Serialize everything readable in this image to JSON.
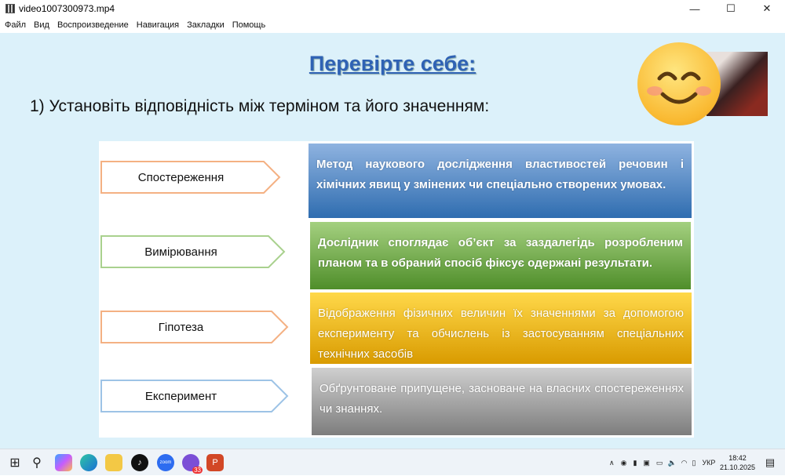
{
  "window": {
    "title": "video1007300973.mp4",
    "min": "—",
    "max": "☐",
    "close": "✕"
  },
  "menu": [
    "Файл",
    "Вид",
    "Воспроизведение",
    "Навигация",
    "Закладки",
    "Помощь"
  ],
  "slide": {
    "title": "Перевірте себе:",
    "subtitle": "1) Установіть відповідність між терміном та його значенням:",
    "terms": [
      {
        "label": "Спостереження",
        "color": "#f4b183"
      },
      {
        "label": "Вимірювання",
        "color": "#a9d18e"
      },
      {
        "label": "Гіпотеза",
        "color": "#f4b183"
      },
      {
        "label": "Експеримент",
        "color": "#9dc3e6"
      }
    ],
    "definitions": [
      "Метод наукового дослідження властивостей речовин і хімічних явищ  у змінених чи спеціально створених умовах.",
      "Дослідник споглядає об’єкт за заздалегідь розробленим планом та в обраний спосіб фіксує одержані результати.",
      "Відображення фізичних величин їх значеннями за допомогою експерименту та обчислень із застосуванням спеціальних технічних засобів",
      "Обґрунтоване припущене, засноване на власних спостереженнях чи знаннях."
    ]
  },
  "taskbar": {
    "badge": "33",
    "lang": "УКР",
    "time": "18:42",
    "date": "21.10.2025"
  }
}
